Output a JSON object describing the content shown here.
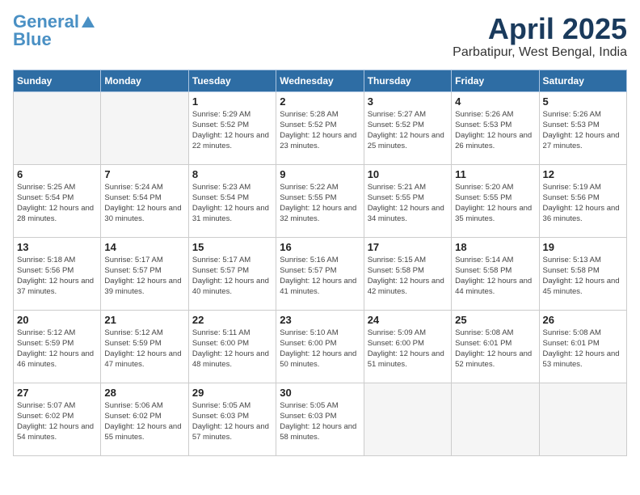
{
  "header": {
    "logo_general": "General",
    "logo_blue": "Blue",
    "month_title": "April 2025",
    "location": "Parbatipur, West Bengal, India"
  },
  "days_of_week": [
    "Sunday",
    "Monday",
    "Tuesday",
    "Wednesday",
    "Thursday",
    "Friday",
    "Saturday"
  ],
  "weeks": [
    [
      {
        "day": "",
        "empty": true
      },
      {
        "day": "",
        "empty": true
      },
      {
        "day": "1",
        "sunrise": "5:29 AM",
        "sunset": "5:52 PM",
        "daylight": "12 hours and 22 minutes."
      },
      {
        "day": "2",
        "sunrise": "5:28 AM",
        "sunset": "5:52 PM",
        "daylight": "12 hours and 23 minutes."
      },
      {
        "day": "3",
        "sunrise": "5:27 AM",
        "sunset": "5:52 PM",
        "daylight": "12 hours and 25 minutes."
      },
      {
        "day": "4",
        "sunrise": "5:26 AM",
        "sunset": "5:53 PM",
        "daylight": "12 hours and 26 minutes."
      },
      {
        "day": "5",
        "sunrise": "5:26 AM",
        "sunset": "5:53 PM",
        "daylight": "12 hours and 27 minutes."
      }
    ],
    [
      {
        "day": "6",
        "sunrise": "5:25 AM",
        "sunset": "5:54 PM",
        "daylight": "12 hours and 28 minutes."
      },
      {
        "day": "7",
        "sunrise": "5:24 AM",
        "sunset": "5:54 PM",
        "daylight": "12 hours and 30 minutes."
      },
      {
        "day": "8",
        "sunrise": "5:23 AM",
        "sunset": "5:54 PM",
        "daylight": "12 hours and 31 minutes."
      },
      {
        "day": "9",
        "sunrise": "5:22 AM",
        "sunset": "5:55 PM",
        "daylight": "12 hours and 32 minutes."
      },
      {
        "day": "10",
        "sunrise": "5:21 AM",
        "sunset": "5:55 PM",
        "daylight": "12 hours and 34 minutes."
      },
      {
        "day": "11",
        "sunrise": "5:20 AM",
        "sunset": "5:55 PM",
        "daylight": "12 hours and 35 minutes."
      },
      {
        "day": "12",
        "sunrise": "5:19 AM",
        "sunset": "5:56 PM",
        "daylight": "12 hours and 36 minutes."
      }
    ],
    [
      {
        "day": "13",
        "sunrise": "5:18 AM",
        "sunset": "5:56 PM",
        "daylight": "12 hours and 37 minutes."
      },
      {
        "day": "14",
        "sunrise": "5:17 AM",
        "sunset": "5:57 PM",
        "daylight": "12 hours and 39 minutes."
      },
      {
        "day": "15",
        "sunrise": "5:17 AM",
        "sunset": "5:57 PM",
        "daylight": "12 hours and 40 minutes."
      },
      {
        "day": "16",
        "sunrise": "5:16 AM",
        "sunset": "5:57 PM",
        "daylight": "12 hours and 41 minutes."
      },
      {
        "day": "17",
        "sunrise": "5:15 AM",
        "sunset": "5:58 PM",
        "daylight": "12 hours and 42 minutes."
      },
      {
        "day": "18",
        "sunrise": "5:14 AM",
        "sunset": "5:58 PM",
        "daylight": "12 hours and 44 minutes."
      },
      {
        "day": "19",
        "sunrise": "5:13 AM",
        "sunset": "5:58 PM",
        "daylight": "12 hours and 45 minutes."
      }
    ],
    [
      {
        "day": "20",
        "sunrise": "5:12 AM",
        "sunset": "5:59 PM",
        "daylight": "12 hours and 46 minutes."
      },
      {
        "day": "21",
        "sunrise": "5:12 AM",
        "sunset": "5:59 PM",
        "daylight": "12 hours and 47 minutes."
      },
      {
        "day": "22",
        "sunrise": "5:11 AM",
        "sunset": "6:00 PM",
        "daylight": "12 hours and 48 minutes."
      },
      {
        "day": "23",
        "sunrise": "5:10 AM",
        "sunset": "6:00 PM",
        "daylight": "12 hours and 50 minutes."
      },
      {
        "day": "24",
        "sunrise": "5:09 AM",
        "sunset": "6:00 PM",
        "daylight": "12 hours and 51 minutes."
      },
      {
        "day": "25",
        "sunrise": "5:08 AM",
        "sunset": "6:01 PM",
        "daylight": "12 hours and 52 minutes."
      },
      {
        "day": "26",
        "sunrise": "5:08 AM",
        "sunset": "6:01 PM",
        "daylight": "12 hours and 53 minutes."
      }
    ],
    [
      {
        "day": "27",
        "sunrise": "5:07 AM",
        "sunset": "6:02 PM",
        "daylight": "12 hours and 54 minutes."
      },
      {
        "day": "28",
        "sunrise": "5:06 AM",
        "sunset": "6:02 PM",
        "daylight": "12 hours and 55 minutes."
      },
      {
        "day": "29",
        "sunrise": "5:05 AM",
        "sunset": "6:03 PM",
        "daylight": "12 hours and 57 minutes."
      },
      {
        "day": "30",
        "sunrise": "5:05 AM",
        "sunset": "6:03 PM",
        "daylight": "12 hours and 58 minutes."
      },
      {
        "day": "",
        "empty": true
      },
      {
        "day": "",
        "empty": true
      },
      {
        "day": "",
        "empty": true
      }
    ]
  ]
}
